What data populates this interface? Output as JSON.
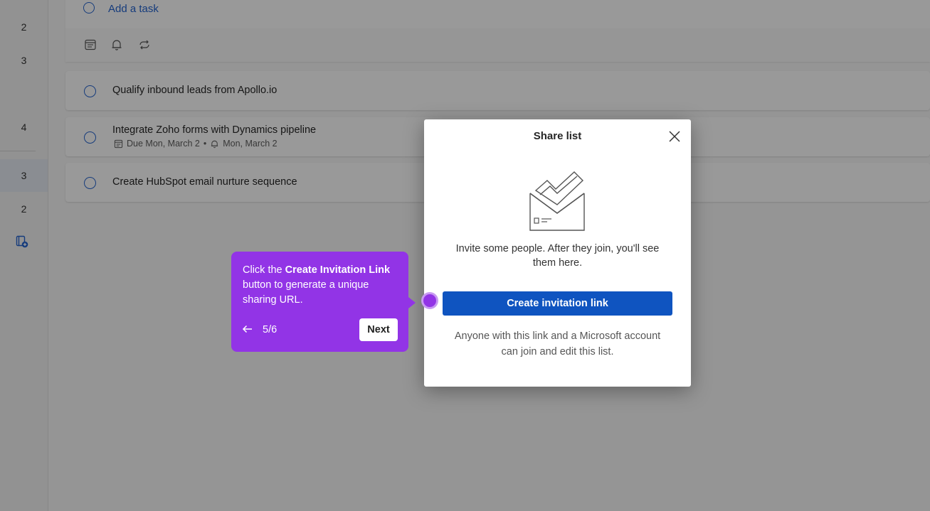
{
  "sidebar": {
    "counts": [
      "2",
      "3",
      "4",
      "3",
      "2"
    ]
  },
  "add_task": {
    "label": "Add a task"
  },
  "tasks": [
    {
      "title": "Qualify inbound leads from Apollo.io"
    },
    {
      "title": "Integrate Zoho forms with Dynamics pipeline",
      "due": "Due Mon, March 2",
      "separator": "•",
      "reminder": "Mon, March 2"
    },
    {
      "title": "Create HubSpot email nurture sequence"
    }
  ],
  "dialog": {
    "title": "Share list",
    "message": "Invite some people. After they join, you'll see them here.",
    "button_label": "Create invitation link",
    "note": "Anyone with this link and a Microsoft account can join and edit this list."
  },
  "guide": {
    "text_prefix": "Click the ",
    "text_bold": "Create Invitation Link",
    "text_suffix": " button to generate a unique sharing URL.",
    "progress": "5/6",
    "next_label": "Next"
  },
  "colors": {
    "accent": "#2564cf",
    "button": "#0f54c0",
    "guide": "#9234e6"
  }
}
